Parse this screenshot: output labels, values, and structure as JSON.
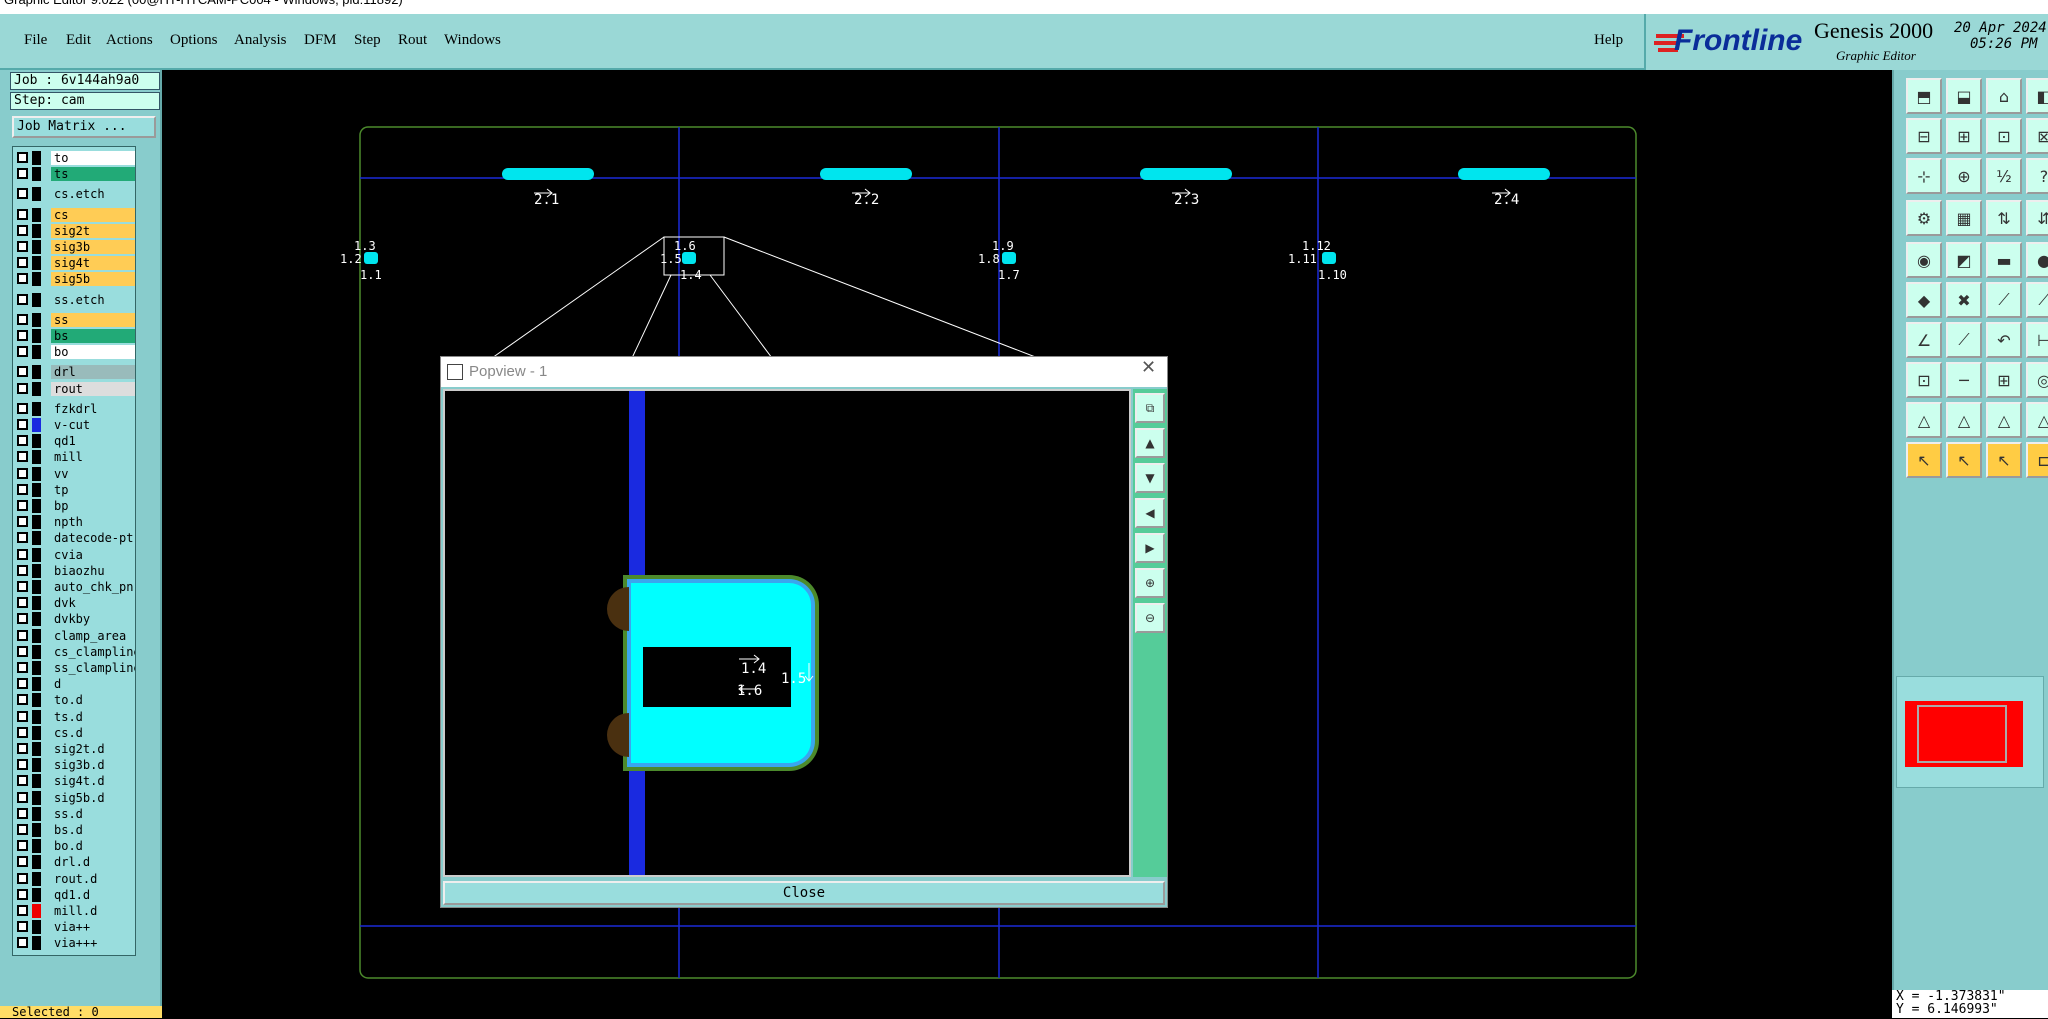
{
  "title_strip": "Graphic Editor 9.0Z2 (00@HT-HTCAM-PC004 - Windows, pid:11892)",
  "menu": {
    "items": [
      "File",
      "Edit",
      "Actions",
      "Options",
      "Analysis",
      "DFM",
      "Step",
      "Rout",
      "Windows"
    ],
    "help": "Help"
  },
  "brand": {
    "logo": "Frontline",
    "product": "Genesis 2000",
    "subtitle": "Graphic Editor",
    "date": "20 Apr 2024",
    "time": "05:26 PM"
  },
  "left_panel": {
    "job": "Job : 6v144ah9a0",
    "step": "Step: cam",
    "job_matrix": "Job Matrix ...",
    "selected": "Selected : 0",
    "layers": [
      {
        "name": "to",
        "color": "#ffffff"
      },
      {
        "name": "ts",
        "color": "#22aa77"
      },
      {
        "name": "cs.etch",
        "color": "#9dd"
      },
      {
        "name": "cs",
        "color": "#ffcc55"
      },
      {
        "name": "sig2t",
        "color": "#ffcc55"
      },
      {
        "name": "sig3b",
        "color": "#ffcc55"
      },
      {
        "name": "sig4t",
        "color": "#ffcc55"
      },
      {
        "name": "sig5b",
        "color": "#ffcc55"
      },
      {
        "name": "ss.etch",
        "color": "#9dd"
      },
      {
        "name": "ss",
        "color": "#ffcc55"
      },
      {
        "name": "bs",
        "color": "#22aa77"
      },
      {
        "name": "bo",
        "color": "#ffffff"
      },
      {
        "name": "drl",
        "color": "#99bbbb"
      },
      {
        "name": "rout",
        "color": "#dddddd"
      },
      {
        "name": "fzkdrl",
        "color": "#9dd"
      },
      {
        "name": "v-cut",
        "color": "#9dd"
      },
      {
        "name": "qd1",
        "color": "#9dd"
      },
      {
        "name": "mill",
        "color": "#9dd"
      },
      {
        "name": "vv",
        "color": "#9dd"
      },
      {
        "name": "tp",
        "color": "#9dd"
      },
      {
        "name": "bp",
        "color": "#9dd"
      },
      {
        "name": "npth",
        "color": "#9dd"
      },
      {
        "name": "datecode-pt",
        "color": "#9dd"
      },
      {
        "name": "cvia",
        "color": "#9dd"
      },
      {
        "name": "biaozhu",
        "color": "#9dd"
      },
      {
        "name": "auto_chk_pn",
        "color": "#9dd"
      },
      {
        "name": "dvk",
        "color": "#9dd"
      },
      {
        "name": "dvkby",
        "color": "#9dd"
      },
      {
        "name": "clamp_area",
        "color": "#9dd"
      },
      {
        "name": "cs_clampline",
        "color": "#9dd"
      },
      {
        "name": "ss_clampline",
        "color": "#9dd"
      },
      {
        "name": "d",
        "color": "#9dd"
      },
      {
        "name": "to.d",
        "color": "#9dd"
      },
      {
        "name": "ts.d",
        "color": "#9dd"
      },
      {
        "name": "cs.d",
        "color": "#9dd"
      },
      {
        "name": "sig2t.d",
        "color": "#9dd"
      },
      {
        "name": "sig3b.d",
        "color": "#9dd"
      },
      {
        "name": "sig4t.d",
        "color": "#9dd"
      },
      {
        "name": "sig5b.d",
        "color": "#9dd"
      },
      {
        "name": "ss.d",
        "color": "#9dd"
      },
      {
        "name": "bs.d",
        "color": "#9dd"
      },
      {
        "name": "bo.d",
        "color": "#9dd"
      },
      {
        "name": "drl.d",
        "color": "#9dd"
      },
      {
        "name": "rout.d",
        "color": "#9dd"
      },
      {
        "name": "qd1.d",
        "color": "#9dd"
      },
      {
        "name": "mill.d",
        "color": "#9dd"
      },
      {
        "name": "via++",
        "color": "#9dd"
      },
      {
        "name": "via+++",
        "color": "#9dd"
      }
    ]
  },
  "canvas_labels": {
    "top": [
      "2.1",
      "2.2",
      "2.3",
      "2.4"
    ],
    "pads": [
      "1.3",
      "1.2",
      "1.1",
      "1.6",
      "1.5",
      "1.4",
      "1.9",
      "1.8",
      "1.7",
      "1.12",
      "1.11",
      "1.10"
    ]
  },
  "popview": {
    "title": "Popview - 1",
    "close": "Close",
    "labels": [
      "1.4",
      "1.5",
      "1.6"
    ]
  },
  "coords": {
    "x": "X = -1.373831\"",
    "y": "Y = 6.146993\""
  }
}
